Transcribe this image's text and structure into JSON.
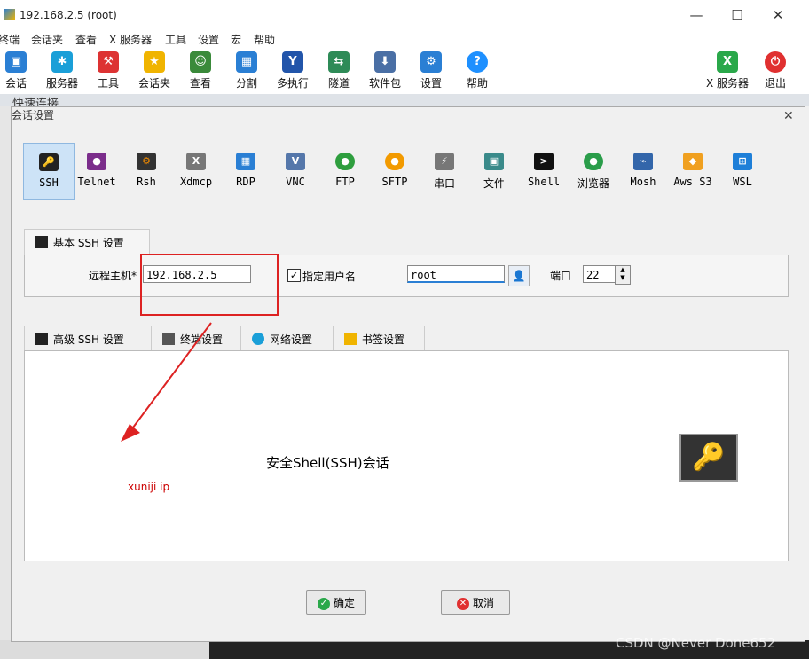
{
  "window": {
    "title": "192.168.2.5 (root)",
    "minimize": "—",
    "maximize": "☐",
    "close": "✕"
  },
  "menu": [
    "终端",
    "会话夹",
    "查看",
    "X 服务器",
    "工具",
    "设置",
    "宏",
    "帮助"
  ],
  "toolbar": [
    {
      "label": "会话",
      "icon": "session-icon",
      "color": "#2a7fd4"
    },
    {
      "label": "服务器",
      "icon": "servers-icon",
      "color": "#1a9fd8"
    },
    {
      "label": "工具",
      "icon": "tools-icon",
      "color": "#d33"
    },
    {
      "label": "会话夹",
      "icon": "star-icon",
      "color": "#f0b400"
    },
    {
      "label": "查看",
      "icon": "view-icon",
      "color": "#3a8a3a"
    },
    {
      "label": "分割",
      "icon": "split-icon",
      "color": "#2a7fd4"
    },
    {
      "label": "多执行",
      "icon": "multiexec-icon",
      "color": "#2255aa"
    },
    {
      "label": "隧道",
      "icon": "tunnel-icon",
      "color": "#2e8b57"
    },
    {
      "label": "软件包",
      "icon": "packages-icon",
      "color": "#4a6fa5"
    },
    {
      "label": "设置",
      "icon": "settings-icon",
      "color": "#2a7fd4"
    },
    {
      "label": "帮助",
      "icon": "help-icon",
      "color": "#1e90ff"
    },
    {
      "label": "X 服务器",
      "icon": "xserver-icon",
      "color": "#2aa84a"
    },
    {
      "label": "退出",
      "icon": "exit-icon",
      "color": "#e03030"
    }
  ],
  "quick_connect": "快速连接",
  "dialog": {
    "title": "会话设置",
    "close": "✕",
    "session_types": [
      {
        "label": "SSH",
        "icon": "ssh-icon",
        "color": "#222",
        "glyph": "🔑"
      },
      {
        "label": "Telnet",
        "icon": "telnet-icon",
        "color": "#7b2d8b",
        "glyph": "●"
      },
      {
        "label": "Rsh",
        "icon": "rsh-icon",
        "color": "#333",
        "glyph": "⚙"
      },
      {
        "label": "Xdmcp",
        "icon": "xdmcp-icon",
        "color": "#555",
        "glyph": "X"
      },
      {
        "label": "RDP",
        "icon": "rdp-icon",
        "color": "#2a7fd4",
        "glyph": "▦"
      },
      {
        "label": "VNC",
        "icon": "vnc-icon",
        "color": "#5577aa",
        "glyph": "V"
      },
      {
        "label": "FTP",
        "icon": "ftp-icon",
        "color": "#2e9e3e",
        "glyph": "●"
      },
      {
        "label": "SFTP",
        "icon": "sftp-icon",
        "color": "#f29a00",
        "glyph": "●"
      },
      {
        "label": "串口",
        "icon": "serial-icon",
        "color": "#777",
        "glyph": "⚡"
      },
      {
        "label": "文件",
        "icon": "file-icon",
        "color": "#3a8a8a",
        "glyph": "▣"
      },
      {
        "label": "Shell",
        "icon": "shell-icon",
        "color": "#111",
        "glyph": ">"
      },
      {
        "label": "浏览器",
        "icon": "browser-icon",
        "color": "#2a9d4a",
        "glyph": "●"
      },
      {
        "label": "Mosh",
        "icon": "mosh-icon",
        "color": "#3366aa",
        "glyph": "⌁"
      },
      {
        "label": "Aws S3",
        "icon": "aws-icon",
        "color": "#f0a020",
        "glyph": "◆"
      },
      {
        "label": "WSL",
        "icon": "wsl-icon",
        "color": "#1e7fd8",
        "glyph": "⊞"
      }
    ],
    "basic_tab": "基本 SSH 设置",
    "remote_host_label": "远程主机*",
    "remote_host_value": "192.168.2.5",
    "specify_user_label": "指定用户名",
    "username_value": "root",
    "port_label": "端口",
    "port_value": "22",
    "adv_tabs": [
      {
        "label": "高级 SSH 设置",
        "icon": "key-icon",
        "color": "#222"
      },
      {
        "label": "终端设置",
        "icon": "terminal-settings-icon",
        "color": "#555"
      },
      {
        "label": "网络设置",
        "icon": "network-icon",
        "color": "#1a9fd8"
      },
      {
        "label": "书签设置",
        "icon": "bookmark-star-icon",
        "color": "#f0b400"
      }
    ],
    "center_text": "安全Shell(SSH)会话",
    "annotation": "xuniji ip",
    "ok_label": "确定",
    "cancel_label": "取消"
  },
  "watermark": "CSDN @Never Done652"
}
